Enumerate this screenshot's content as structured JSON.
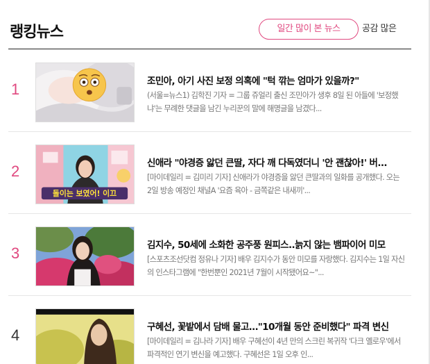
{
  "header": {
    "title": "랭킹뉴스",
    "tab_active": "일간 많이 본 뉴스",
    "tab_other": "공감 많은"
  },
  "articles": [
    {
      "rank": "1",
      "headline": "조민아, 아기 사진 보정 의혹에 \"턱 깎는 엄마가 있을까?\"",
      "summary": "(서울=뉴스1) 김학진 기자 = 그룹 쥬얼리 출신 조민아가 생후 8일 된 아들에 '보정했냐'는 무례한 댓글을 남긴 누리꾼의 말에 해명글을 남겼다...",
      "thumb_icon": "face-with-open-mouth-emoji"
    },
    {
      "rank": "2",
      "headline": "신애라 \"야경증 앓던 큰딸, 자다 깨 다독였더니 '안 괜찮아!' 버...",
      "summary": "[마이데일리 = 김미리 기자] 신애라가 야경증을 앓던 큰딸과의 일화를 공개했다. 오는 2일 방송 예정인 채널A '요즘 육아 - 금쪽같은 내새끼'...",
      "thumb_caption": "돌이는 보였어! 이끄"
    },
    {
      "rank": "3",
      "headline": "김지수, 50세에 소화한 공주풍 원피스..늙지 않는 뱀파이어 미모",
      "summary": "[스포츠조선닷컴 정유나 기자] 배우 김지수가 동안 미모를 자랑했다. 김지수는 1일 자신의 인스타그램에 \"한번뿐인 2021년 7월이 시작됐어요~\"..."
    },
    {
      "rank": "4",
      "headline": "구혜선, 꽃밭에서 담배 물고…\"10개월 동안 준비했다\" 파격 변신",
      "summary": "[마이데일리 = 김나라 기자] 배우 구혜선이 4년 만의 스크린 복귀작 '다크 옐로우'에서 파격적인 연기 변신을 예고했다. 구혜선은 1일 오후 인..."
    }
  ],
  "colors": {
    "accent": "#e0487f",
    "text": "#111111",
    "muted": "#777777"
  }
}
